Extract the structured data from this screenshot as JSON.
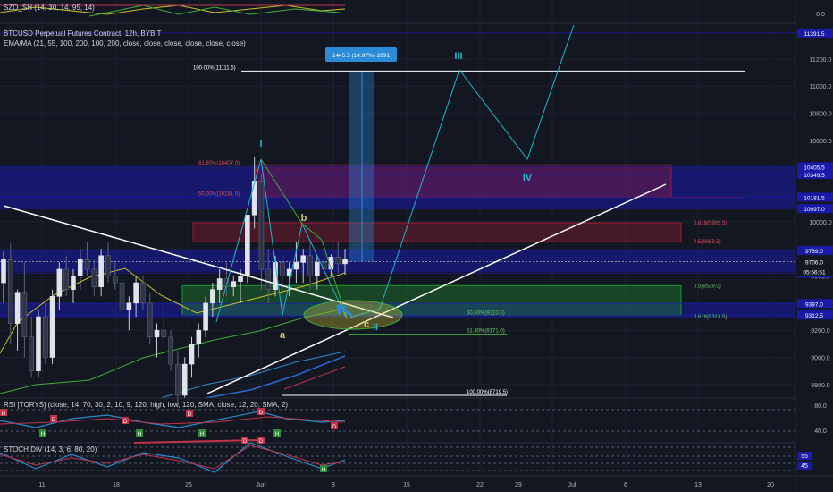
{
  "header": {
    "symbol": "BTCUSD Perpetual Futures Contract, 12h, BYBIT",
    "ema": "EMA/MA (21, 55, 100, 200, 100, 200, close, close, close, close, close, close)",
    "szo": "SZO_SH (14, 30, 14, 95, 14)",
    "rsi": "RSI [TORYS] (close, 14, 70, 30, 2, 10, 9, 120, high, low, 120, SMA, close, 12, 20, SMA, 2)",
    "stoch": "STOCH DIV (14, 3, 6, 80, 20)"
  },
  "colors": {
    "background": "#131722",
    "up": "#e0e3eb",
    "down": "#2f3446",
    "blue_zone": "#1a1aa8",
    "red_zone": "#a31c34",
    "green_zone": "#1f9a2a",
    "wave": "#1fb6c9",
    "trendline": "#ffffff",
    "axis_text": "#b2b5be"
  },
  "chart_data": {
    "type": "candlestick",
    "symbol": "BTCUSD",
    "interval": "12h",
    "exchange": "BYBIT",
    "ylim": [
      8700,
      11450
    ],
    "price_ticks": [
      8800,
      9000,
      9200,
      9400,
      9600,
      9800,
      10000,
      10200,
      10400,
      10600,
      10800,
      11000,
      11200
    ],
    "price_labels": [
      {
        "value": 11391.5,
        "text": "11391.5",
        "color": "#1a1aa8"
      },
      {
        "value": 10405.5,
        "text": "10405.5",
        "color": "#1a1aa8"
      },
      {
        "value": 10349.5,
        "text": "10349.5",
        "color": "#1a1aa8"
      },
      {
        "value": 10181.5,
        "text": "10181.5",
        "color": "#1a1aa8"
      },
      {
        "value": 10097.0,
        "text": "10097.0",
        "color": "#1a1aa8"
      },
      {
        "value": 9789.0,
        "text": "9789.0",
        "color": "#1a1aa8"
      },
      {
        "value": 9706.0,
        "text": "9706.0",
        "color": "#131722"
      },
      {
        "value": 9621.0,
        "text": "9621.0",
        "color": "#1a1aa8"
      },
      {
        "value": 9397.0,
        "text": "9397.0",
        "color": "#1a1aa8"
      },
      {
        "value": 9312.5,
        "text": "9312.5",
        "color": "#1a1aa8"
      }
    ],
    "countdown": "05:56:51",
    "x_labels": [
      "11",
      "18",
      "25",
      "Jun",
      "8",
      "15",
      "22",
      "29",
      "Jul",
      "6",
      "13",
      "20"
    ],
    "candles": [
      [
        9550,
        9780,
        9400,
        9720
      ],
      [
        9720,
        9840,
        9100,
        9250
      ],
      [
        9250,
        9500,
        9050,
        9480
      ],
      [
        9480,
        9700,
        9000,
        9150
      ],
      [
        9150,
        9300,
        8850,
        8900
      ],
      [
        8900,
        9350,
        8850,
        9300
      ],
      [
        9300,
        9400,
        8950,
        9000
      ],
      [
        9000,
        9500,
        8950,
        9450
      ],
      [
        9450,
        9700,
        9350,
        9650
      ],
      [
        9650,
        9750,
        9450,
        9500
      ],
      [
        9500,
        9650,
        9400,
        9600
      ],
      [
        9600,
        9800,
        9500,
        9720
      ],
      [
        9720,
        9850,
        9600,
        9650
      ],
      [
        9650,
        9720,
        9450,
        9520
      ],
      [
        9520,
        9800,
        9450,
        9750
      ],
      [
        9750,
        9850,
        9550,
        9600
      ],
      [
        9600,
        9700,
        9500,
        9550
      ],
      [
        9550,
        9700,
        9300,
        9350
      ],
      [
        9350,
        9450,
        9200,
        9400
      ],
      [
        9400,
        9600,
        9300,
        9550
      ],
      [
        9550,
        9600,
        9350,
        9400
      ],
      [
        9400,
        9480,
        9100,
        9150
      ],
      [
        9150,
        9250,
        9000,
        9200
      ],
      [
        9200,
        9400,
        9100,
        9150
      ],
      [
        9150,
        9200,
        8900,
        8950
      ],
      [
        8950,
        9050,
        8650,
        8720
      ],
      [
        8720,
        9000,
        8700,
        8950
      ],
      [
        8950,
        9150,
        8850,
        9100
      ],
      [
        9100,
        9250,
        9000,
        9200
      ],
      [
        9200,
        9450,
        9150,
        9400
      ],
      [
        9400,
        9550,
        9300,
        9500
      ],
      [
        9500,
        9650,
        9400,
        9580
      ],
      [
        9580,
        9700,
        9450,
        9520
      ],
      [
        9520,
        9600,
        9450,
        9560
      ],
      [
        9560,
        9650,
        9400,
        9600
      ],
      [
        9600,
        9800,
        9550,
        10050
      ],
      [
        10050,
        10480,
        9950,
        10300
      ],
      [
        10300,
        10350,
        9500,
        9650
      ],
      [
        9650,
        9800,
        9400,
        9500
      ],
      [
        9500,
        9750,
        9450,
        9700
      ],
      [
        9700,
        9750,
        9300,
        9600
      ],
      [
        9600,
        9700,
        9450,
        9650
      ],
      [
        9650,
        9850,
        9550,
        9700
      ],
      [
        9700,
        9800,
        9550,
        9750
      ],
      [
        9750,
        9850,
        9500,
        9600
      ],
      [
        9600,
        9750,
        9500,
        9700
      ],
      [
        9700,
        9800,
        9550,
        9650
      ],
      [
        9650,
        9760,
        9600,
        9740
      ],
      [
        9740,
        9850,
        9620,
        9690
      ],
      [
        9690,
        9800,
        9610,
        9720
      ]
    ],
    "zones": [
      {
        "name": "blue-zone-top",
        "from": 10097,
        "to": 10400,
        "color": "#1a1aa8"
      },
      {
        "name": "blue-zone-mid",
        "from": 9630,
        "to": 9790,
        "color": "#1a1aa8"
      },
      {
        "name": "blue-zone-low",
        "from": 9290,
        "to": 9400,
        "color": "#1a1aa8"
      },
      {
        "name": "red-zone-upper",
        "from": 10181,
        "to": 10420,
        "color": "#a31c34"
      },
      {
        "name": "red-zone-lower",
        "from": 9853,
        "to": 9992,
        "color": "#a31c34"
      },
      {
        "name": "green-zone",
        "from": 9312,
        "to": 9529,
        "color": "#1f9a2a"
      }
    ],
    "fib_labels": [
      {
        "text": "100.00%(11111.5)",
        "value": 11111.5,
        "color": "#ffffff"
      },
      {
        "text": "61.80%(10407.0)",
        "value": 10407.0,
        "color": "#e04b5e"
      },
      {
        "text": "50.00%(10181.0)",
        "value": 10181.0,
        "color": "#e04b5e"
      },
      {
        "text": "0.618(9992.5)",
        "value": 9992.5,
        "color": "#e04b5e"
      },
      {
        "text": "0.5(9853.5)",
        "value": 9853.5,
        "color": "#e04b5e"
      },
      {
        "text": "0.5(9529.0)",
        "value": 9529.0,
        "color": "#6ccf5f"
      },
      {
        "text": "50.00%(9310.5)",
        "value": 9310.5,
        "color": "#6ccf5f"
      },
      {
        "text": "0.618(9313.5)",
        "value": 9313.5,
        "color": "#6ccf5f"
      },
      {
        "text": "61.80%(9171.0)",
        "value": 9171.0,
        "color": "#6ccf5f"
      },
      {
        "text": "100.00%(8719.5)",
        "value": 8719.5,
        "color": "#ffffff"
      }
    ],
    "measure_label": "1445.5 (14.97%) 2891",
    "wave_labels": [
      {
        "text": "I",
        "color": "#1fb6c9"
      },
      {
        "text": "b",
        "color": "#d8c27a"
      },
      {
        "text": "a",
        "color": "#d8c27a"
      },
      {
        "text": "c",
        "color": "#d8c27a"
      },
      {
        "text": "II",
        "color": "#1fb6c9"
      },
      {
        "text": "III",
        "color": "#1fb6c9"
      },
      {
        "text": "IV",
        "color": "#1fb6c9"
      }
    ],
    "rsi": {
      "ticks": [
        80.0,
        40.0
      ]
    },
    "stoch": {
      "ticks": [
        55,
        45
      ]
    },
    "szo": {
      "ticks": [
        0.0
      ]
    }
  }
}
